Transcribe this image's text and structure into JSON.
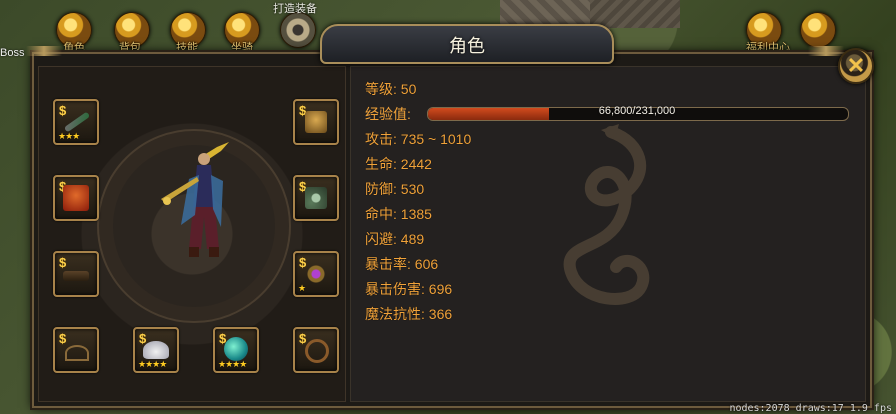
{
  "top_bar": {
    "icons": [
      {
        "name": "character-icon",
        "label": "角色"
      },
      {
        "name": "bag-icon",
        "label": "背包"
      },
      {
        "name": "skills-icon",
        "label": "技能"
      },
      {
        "name": "mount-icon",
        "label": "坐骑"
      },
      {
        "name": "forge-icon",
        "label": "打造装备"
      }
    ],
    "right_icons": [
      {
        "name": "gift-bag-icon",
        "label": "福利中心"
      },
      {
        "name": "treasure-chest-icon",
        "label": ""
      }
    ]
  },
  "map": {
    "boss_label": "Boss"
  },
  "panel": {
    "title": "角色"
  },
  "equipment": {
    "slots": [
      {
        "name": "weapon-slot",
        "stars": "★★★"
      },
      {
        "name": "helmet-slot",
        "stars": ""
      },
      {
        "name": "armor-slot",
        "stars": ""
      },
      {
        "name": "necklace-slot",
        "stars": ""
      },
      {
        "name": "belt-slot",
        "stars": ""
      },
      {
        "name": "ring-slot",
        "stars": "★"
      },
      {
        "name": "boots-slot",
        "stars": ""
      },
      {
        "name": "wings-slot",
        "stars": "★★★★"
      },
      {
        "name": "orb-slot",
        "stars": "★★★★"
      },
      {
        "name": "bracer-slot",
        "stars": ""
      }
    ],
    "lock_symbol": "$"
  },
  "stats": {
    "level": "等级: 50",
    "exp_label": "经验值:",
    "exp_text": "66,800/231,000",
    "exp_current": 66800,
    "exp_max": 231000,
    "attack": "攻击: 735 ~ 1010",
    "hp": "生命: 2442",
    "defense": "防御: 530",
    "hit": "命中: 1385",
    "dodge": "闪避: 489",
    "crit_rate": "暴击率: 606",
    "crit_damage": "暴击伤害: 696",
    "magic_resist": "魔法抗性: 366"
  },
  "debug": {
    "text": "nodes:2078 draws:17 1.9 fps"
  },
  "colors": {
    "stat_text": "#f0a23a",
    "exp_fill": "#c8441a",
    "frame": "#a8834a"
  }
}
